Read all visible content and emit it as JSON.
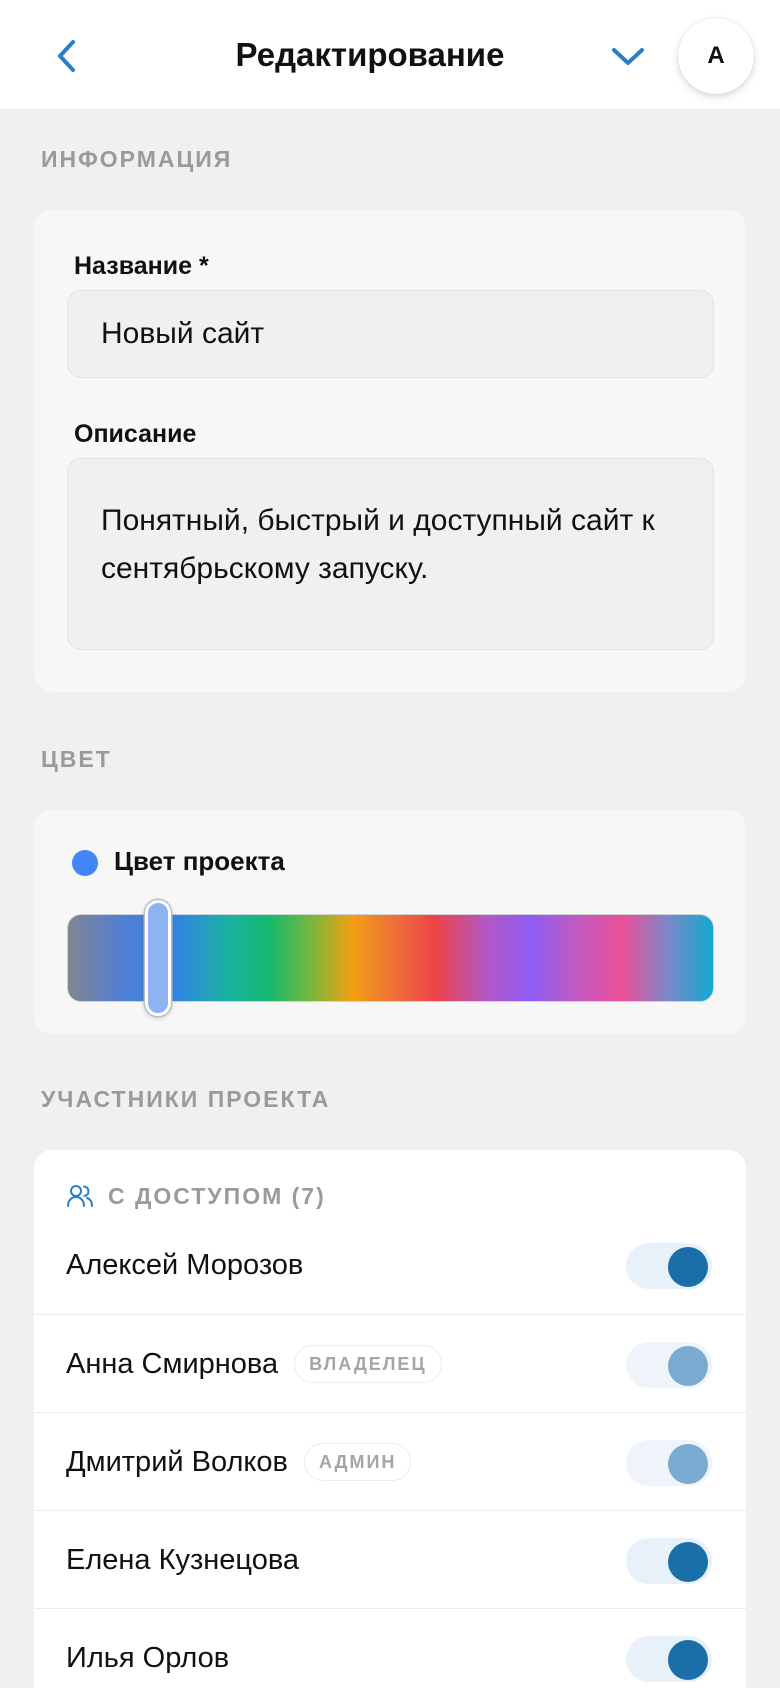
{
  "header": {
    "title": "Редактирование",
    "avatar_initial": "A"
  },
  "sections": {
    "info": "ИНФОРМАЦИЯ",
    "color": "ЦВЕТ",
    "members": "УЧАСТНИКИ ПРОЕКТА"
  },
  "form": {
    "name_label": "Название *",
    "name_value": "Новый сайт",
    "description_label": "Описание",
    "description_value": "Понятный, быстрый и доступный сайт к сентябрьскому запуску."
  },
  "color": {
    "title": "Цвет проекта",
    "selected_hex": "#4285f4",
    "slider_position": 0.14
  },
  "members": {
    "access_header": "С ДОСТУПОМ (7)",
    "list": [
      {
        "name": "Алексей Морозов",
        "role": "",
        "enabled": true,
        "locked": false
      },
      {
        "name": "Анна Смирнова",
        "role": "ВЛАДЕЛЕЦ",
        "enabled": true,
        "locked": true
      },
      {
        "name": "Дмитрий Волков",
        "role": "АДМИН",
        "enabled": true,
        "locked": true
      },
      {
        "name": "Елена Кузнецова",
        "role": "",
        "enabled": true,
        "locked": false
      },
      {
        "name": "Илья Орлов",
        "role": "",
        "enabled": true,
        "locked": false
      }
    ]
  },
  "colors": {
    "accent": "#2a7fc4",
    "toggle_on": "#1a6fa8",
    "toggle_locked": "#79abd0",
    "muted_text": "#9a9a9a"
  }
}
